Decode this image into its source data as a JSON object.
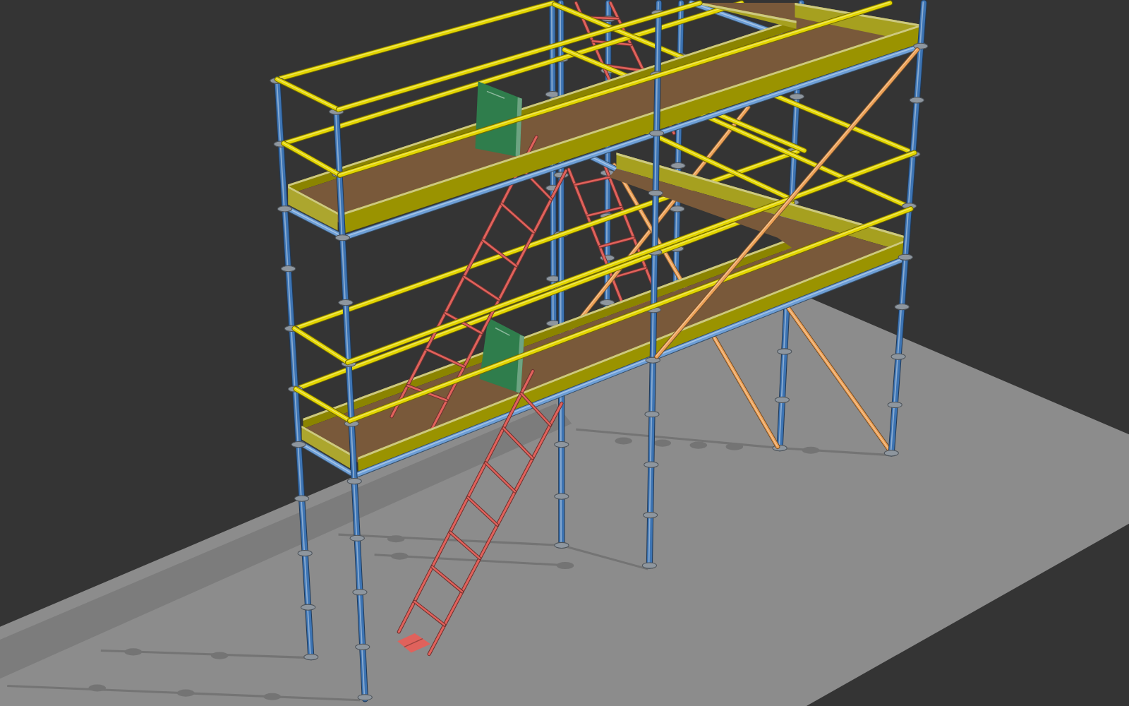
{
  "scene": {
    "components": [
      {
        "kind": "standard",
        "color": "#3d74b3"
      },
      {
        "kind": "ledger",
        "color": "#6e9fd6"
      },
      {
        "kind": "guardrail",
        "color": "#e3d500"
      },
      {
        "kind": "toe_board",
        "color": "#9a9300"
      },
      {
        "kind": "deck",
        "color": "#79593a"
      },
      {
        "kind": "hatch",
        "color": "#2f7d4c"
      },
      {
        "kind": "ladder",
        "color": "#e0625c"
      },
      {
        "kind": "brace",
        "color": "#eda258"
      }
    ]
  }
}
